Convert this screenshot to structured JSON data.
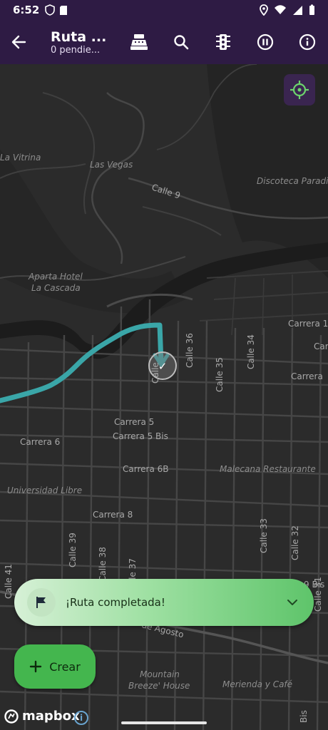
{
  "status_bar": {
    "time": "6:52"
  },
  "app_bar": {
    "title": "Ruta ...",
    "subtitle": "0 pendie...",
    "actions": [
      {
        "name": "cash-register-button",
        "icon": "cash-register-icon"
      },
      {
        "name": "search-button",
        "icon": "search-icon"
      },
      {
        "name": "traffic-light-button",
        "icon": "traffic-light-icon"
      },
      {
        "name": "pause-button",
        "icon": "pause-circle-icon"
      },
      {
        "name": "info-button",
        "icon": "info-circle-icon"
      }
    ]
  },
  "map": {
    "labels": {
      "la_vitrina": "La Vitrina",
      "las_vegas": "Las Vegas",
      "calle_9": "Calle 9",
      "discoteca": "Discoteca Paradis",
      "aparta_hotel_1": "Aparta Hotel",
      "aparta_hotel_2": "La Cascada",
      "carrera_1": "Carrera 1",
      "carrera_short": "Carre",
      "carrera": "Carrera",
      "calle_36": "Calle 36",
      "calle_34": "Calle 34",
      "calle_35": "Calle 35",
      "calle_partial": "Calle",
      "carrera_5": "Carrera 5",
      "carrera_5_bis": "Carrera 5 Bis",
      "carrera_6": "Carrera 6",
      "carrera_6b": "Carrera 6B",
      "malecana": "Malecana Restaurante",
      "universidad": "Universidad Libre",
      "carrera_8": "Carrera 8",
      "calle_39": "Calle 39",
      "calle_38": "Calle 38",
      "calle_37": "Calle 37",
      "calle_33": "Calle 33",
      "calle_32": "Calle 32",
      "calle_41": "Calle 41",
      "calle_31": "Calle 31",
      "nine_bis": "9 Bis",
      "de_agosto": "de Agosto",
      "mountain_1": "Mountain",
      "mountain_2": "Breeze' House",
      "merienda": "Merienda y Café",
      "bis": "Bis"
    },
    "checkpoint_mark": "✓"
  },
  "banner": {
    "text": "¡Ruta completada!",
    "icon": "flag-icon"
  },
  "fab": {
    "label": "Crear",
    "icon": "plus-icon"
  },
  "attribution": {
    "logo_text": "mapbox",
    "info_glyph": "i"
  },
  "colors": {
    "app_bar": "#2e1b44",
    "route": "#3aa6a8",
    "banner_accent": "#5ec46a",
    "fab": "#44b64e"
  }
}
